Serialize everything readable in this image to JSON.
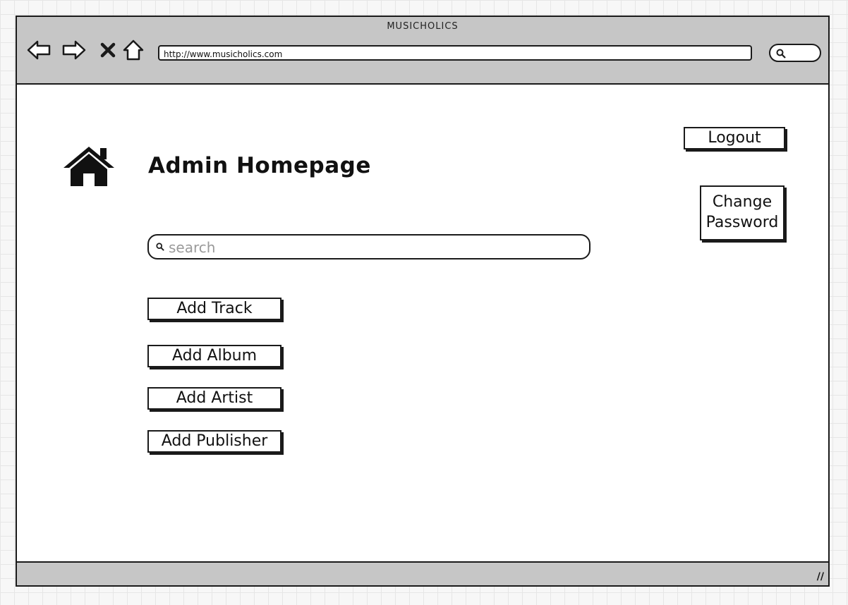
{
  "window": {
    "title": "MUSICHOLICS",
    "url": "http://www.musicholics.com",
    "resize_grip": "//"
  },
  "page": {
    "title": "Admin Homepage"
  },
  "header_actions": {
    "logout_label": "Logout",
    "change_password_line1": "Change",
    "change_password_line2": "Password"
  },
  "search": {
    "placeholder": "search"
  },
  "actions": [
    {
      "label": "Add Track"
    },
    {
      "label": "Add Album"
    },
    {
      "label": "Add Artist"
    },
    {
      "label": "Add Publisher"
    }
  ],
  "icons": {
    "back": "arrow-left-icon",
    "forward": "arrow-right-icon",
    "stop": "close-icon",
    "home_nav": "home-outline-icon",
    "page_home": "home-icon",
    "search": "search-icon"
  },
  "colors": {
    "chrome": "#c6c6c6",
    "ink": "#1a1a1a",
    "placeholder": "#9a9a9a"
  }
}
